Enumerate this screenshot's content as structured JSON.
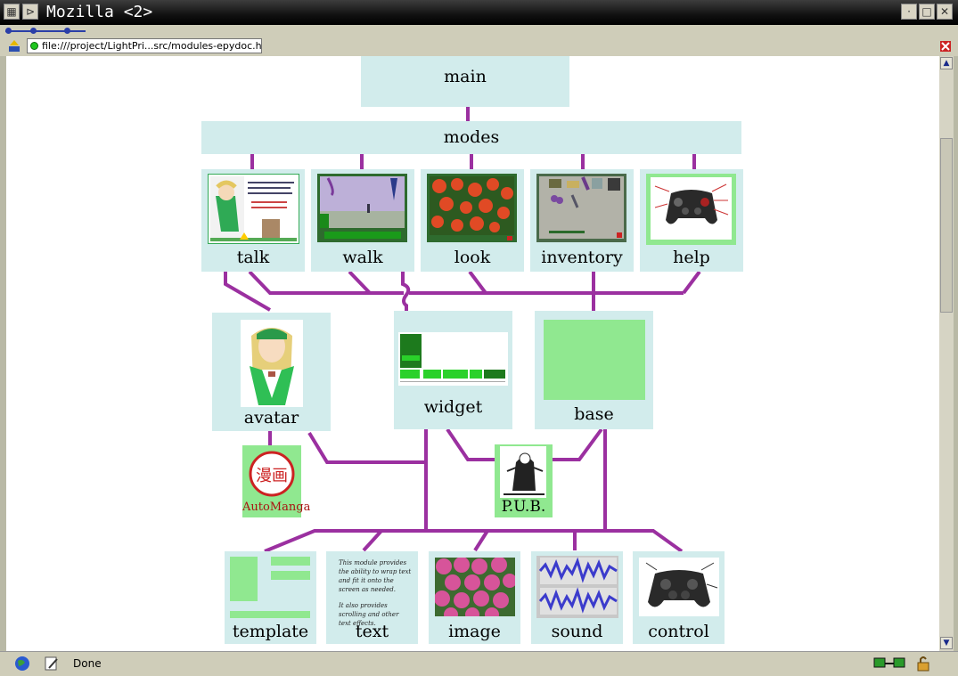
{
  "window": {
    "title": "Mozilla <2>"
  },
  "urlbar": {
    "url": "file:///project/LightPri...src/modules-epydoc.html"
  },
  "status": {
    "text": "Done"
  },
  "diagram": {
    "top": {
      "main": "main",
      "modes": "modes"
    },
    "modes": [
      "talk",
      "walk",
      "look",
      "inventory",
      "help"
    ],
    "middle": {
      "avatar": "avatar",
      "widget": "widget",
      "base": "base"
    },
    "logos": {
      "automanga": "AutoManga",
      "pub": "P.U.B.",
      "automanga_kanji": "漫画"
    },
    "bottom": [
      "template",
      "text",
      "image",
      "sound",
      "control"
    ],
    "text_thumb": {
      "p1": "This module provides the ability to wrap text and fit it onto the screen as needed.",
      "p2": "It also provides scrolling and other text effects."
    }
  },
  "colors": {
    "node_bg": "#d2ecec",
    "edge": "#9b30a0",
    "thumb_green": "#90e890"
  }
}
